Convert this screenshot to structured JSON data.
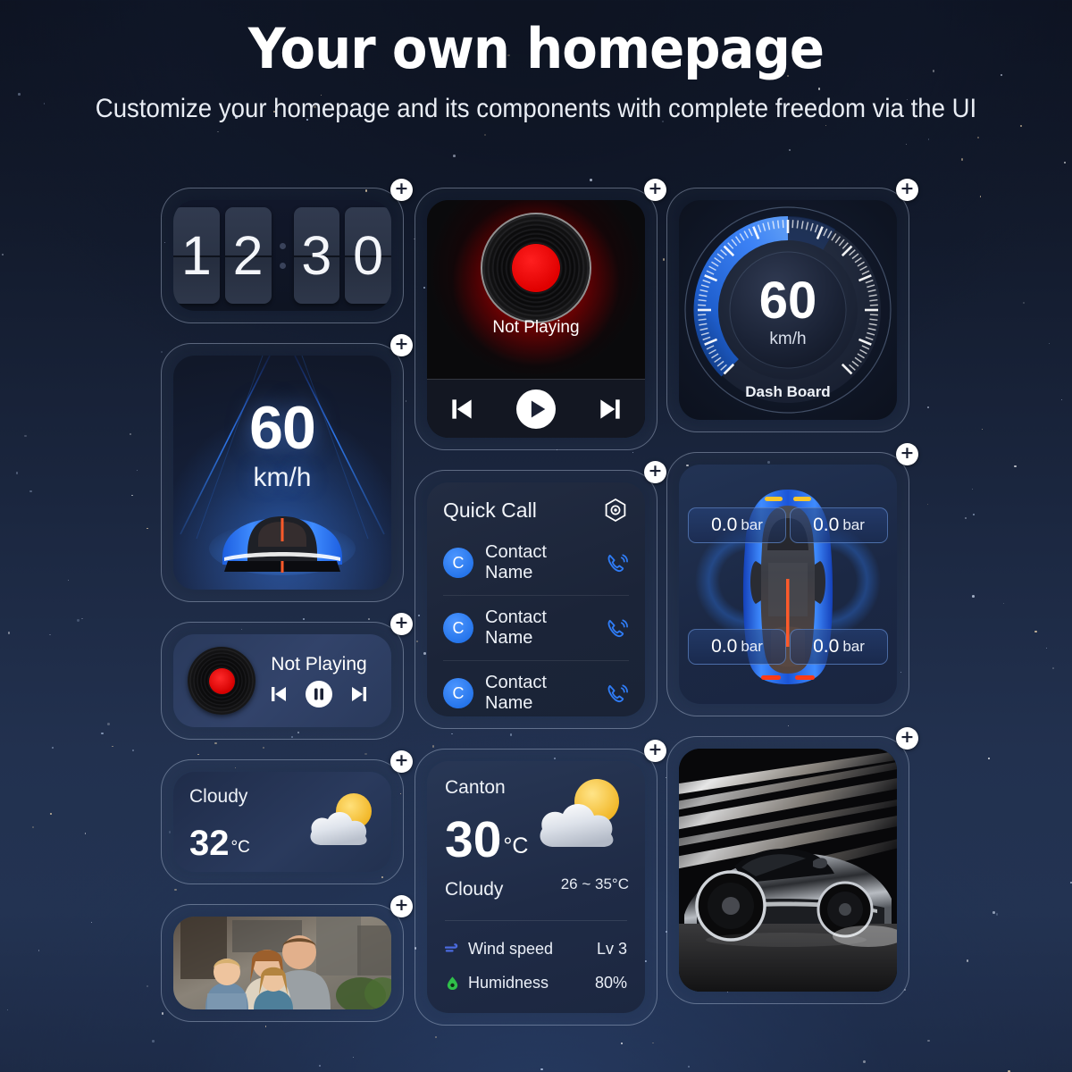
{
  "header": {
    "title": "Your own homepage",
    "subtitle": "Customize your homepage and its components with complete freedom via the UI"
  },
  "add_button_label": "+",
  "widgets": {
    "clock": {
      "name": "flip-clock",
      "digits": [
        "1",
        "2",
        "3",
        "0"
      ],
      "time": "12:30"
    },
    "hud": {
      "name": "hud-speed",
      "speed": "60",
      "unit": "km/h"
    },
    "mini_player": {
      "name": "mini-music-player",
      "status": "Not Playing",
      "prev_icon": "previous-track-icon",
      "play_icon": "pause-icon",
      "next_icon": "next-track-icon"
    },
    "weather_small": {
      "name": "weather-small",
      "condition": "Cloudy",
      "temp": "32",
      "unit": "°C",
      "icon": "sun-behind-cloud-icon"
    },
    "photo": {
      "name": "family-photo",
      "alt": "family photo"
    },
    "music": {
      "name": "music-player",
      "status": "Not Playing",
      "prev_icon": "previous-track-icon",
      "play_icon": "play-icon",
      "next_icon": "next-track-icon"
    },
    "quick_call": {
      "name": "quick-call",
      "title": "Quick Call",
      "settings_icon": "hexagon-settings-icon",
      "contacts": [
        {
          "initial": "C",
          "name": "Contact Name"
        },
        {
          "initial": "C",
          "name": "Contact Name"
        },
        {
          "initial": "C",
          "name": "Contact Name"
        }
      ]
    },
    "weather_large": {
      "name": "weather-large",
      "city": "Canton",
      "temp": "30",
      "unit": "°C",
      "condition": "Cloudy",
      "range": "26 ~ 35°C",
      "icon": "sun-behind-cloud-icon",
      "stats": [
        {
          "icon": "wind-icon",
          "label": "Wind speed",
          "value": "Lv 3"
        },
        {
          "icon": "humidity-icon",
          "label": "Humidness",
          "value": "80%"
        }
      ]
    },
    "dashboard": {
      "name": "dash-board-gauge",
      "speed": "60",
      "unit": "km/h",
      "label": "Dash Board"
    },
    "tire_pressure": {
      "name": "tire-pressure",
      "tires": [
        {
          "position": "front-left",
          "value": "0.0",
          "unit": "bar"
        },
        {
          "position": "front-right",
          "value": "0.0",
          "unit": "bar"
        },
        {
          "position": "rear-left",
          "value": "0.0",
          "unit": "bar"
        },
        {
          "position": "rear-right",
          "value": "0.0",
          "unit": "bar"
        }
      ]
    },
    "car_photo": {
      "name": "car-photo",
      "alt": "sports car light trails"
    }
  },
  "colors": {
    "accent_blue": "#2f7cf6",
    "vinyl_red": "#e00000",
    "sun_yellow": "#f5c33b",
    "background_top": "#0d1220",
    "background_bottom": "#233352"
  }
}
